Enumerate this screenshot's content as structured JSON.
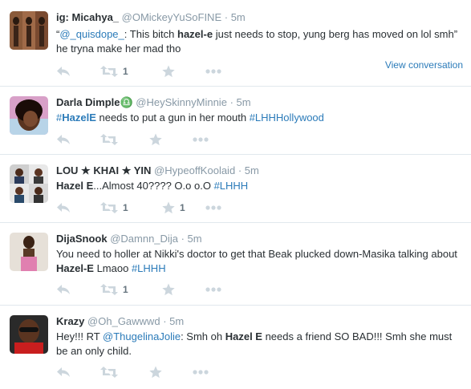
{
  "tweets": [
    {
      "fullname": "ig: Micahya_",
      "handle": "@OMickeyYuSoFINE",
      "sep": "·",
      "time": "5m",
      "text_parts": [
        {
          "t": "“",
          "s": "n"
        },
        {
          "t": "@_quisdope_",
          "s": "l"
        },
        {
          "t": ": This bitch ",
          "s": "n"
        },
        {
          "t": "hazel-e",
          "s": "b"
        },
        {
          "t": " just needs to stop, yung berg has moved on lol smh” he tryna make her mad tho",
          "s": "n"
        }
      ],
      "retweet_count": "1",
      "favorite_count": "",
      "view_conversation": "View conversation"
    },
    {
      "fullname": "Darla Dimple♎",
      "handle": "@HeySkinnyMinnie",
      "sep": "·",
      "time": "5m",
      "text_parts": [
        {
          "t": "#",
          "s": "l"
        },
        {
          "t": "HazelE",
          "s": "lb"
        },
        {
          "t": " needs to put a gun in her mouth ",
          "s": "n"
        },
        {
          "t": "#LHHHollywood",
          "s": "l"
        }
      ],
      "retweet_count": "",
      "favorite_count": ""
    },
    {
      "fullname": "LOU ★ KHAI ★ YIN",
      "handle": "@HypeoffKoolaid",
      "sep": "·",
      "time": "5m",
      "text_parts": [
        {
          "t": "Hazel E",
          "s": "b"
        },
        {
          "t": "...Almost 40???? O.o o.O ",
          "s": "n"
        },
        {
          "t": "#LHHH",
          "s": "l"
        }
      ],
      "retweet_count": "1",
      "favorite_count": "1"
    },
    {
      "fullname": "DijaSnook",
      "handle": "@Damnn_Dija",
      "sep": "·",
      "time": "5m",
      "text_parts": [
        {
          "t": "You need to holler at Nikki's doctor to get that Beak plucked down-Masika talking about ",
          "s": "n"
        },
        {
          "t": "Hazel-E",
          "s": "b"
        },
        {
          "t": " Lmaoo ",
          "s": "n"
        },
        {
          "t": "#LHHH",
          "s": "l"
        }
      ],
      "retweet_count": "1",
      "favorite_count": ""
    },
    {
      "fullname": "Krazy",
      "handle": "@Oh_Gawwwd",
      "sep": "·",
      "time": "5m",
      "text_parts": [
        {
          "t": "Hey!!! RT ",
          "s": "n"
        },
        {
          "t": "@ThugelinaJolie",
          "s": "l"
        },
        {
          "t": ": Smh oh ",
          "s": "n"
        },
        {
          "t": "Hazel E",
          "s": "b"
        },
        {
          "t": " needs a friend SO BAD!!! Smh she must be an only child.",
          "s": "n"
        }
      ],
      "retweet_count": "",
      "favorite_count": ""
    }
  ],
  "icons": {
    "reply": "reply-arrow-icon",
    "retweet": "retweet-arrows-icon",
    "favorite": "star-icon",
    "more": "more-dots-icon"
  },
  "colors": {
    "link": "#2b7bb9",
    "icon": "#ccd6dd",
    "muted": "#8899a6",
    "text": "#292f33",
    "divider": "#e1e8ed"
  }
}
